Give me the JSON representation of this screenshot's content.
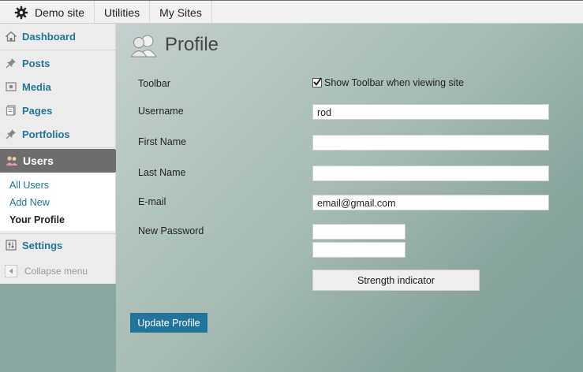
{
  "admin_bar": {
    "site_name": "Demo site",
    "utilities": "Utilities",
    "my_sites": "My Sites"
  },
  "sidebar": {
    "items": [
      {
        "label": "Dashboard",
        "icon": "dashboard-icon"
      },
      {
        "label": "Posts",
        "icon": "pin-icon"
      },
      {
        "label": "Media",
        "icon": "media-icon"
      },
      {
        "label": "Pages",
        "icon": "pages-icon"
      },
      {
        "label": "Portfolios",
        "icon": "pin-icon"
      },
      {
        "label": "Users",
        "icon": "users-icon"
      },
      {
        "label": "Settings",
        "icon": "settings-icon"
      }
    ],
    "submenu": [
      "All Users",
      "Add New",
      "Your Profile"
    ],
    "collapse": "Collapse menu"
  },
  "page": {
    "title": "Profile",
    "fields": {
      "toolbar_label": "Toolbar",
      "toolbar_checkbox": "Show Toolbar when viewing site",
      "username_label": "Username",
      "username_value": "rod",
      "first_name_label": "First Name",
      "first_name_value": "",
      "last_name_label": "Last Name",
      "last_name_value": "",
      "email_label": "E-mail",
      "email_value": "email@gmail.com",
      "password_label": "New Password"
    },
    "strength": "Strength indicator",
    "update_button": "Update Profile"
  },
  "colors": {
    "link": "#21759b",
    "active_menu": "#6e6e6e",
    "button": "#21759b"
  }
}
